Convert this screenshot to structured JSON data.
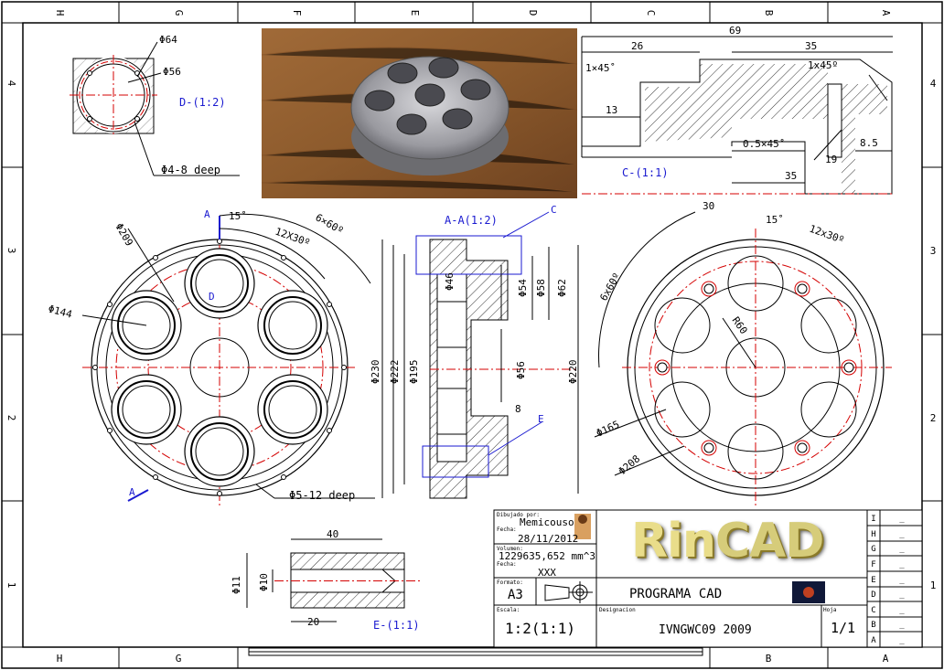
{
  "colors": {
    "line": "#000000",
    "center": "#d40000",
    "annot": "#1a1ad0",
    "hatch": "#000000"
  },
  "border": {
    "cols_top": [
      "H",
      "G",
      "F",
      "E",
      "D",
      "C",
      "B",
      "A"
    ],
    "cols_bottom": [
      "H",
      "G",
      "B",
      "A"
    ],
    "rows": [
      "4",
      "3",
      "2",
      "1"
    ]
  },
  "view_d": {
    "dia64": "Φ64",
    "dia56": "Φ56",
    "label": "D-(1:2)",
    "holes": "Φ4-8 deep"
  },
  "view_c": {
    "d69": "69",
    "d26": "26",
    "d35a": "35",
    "cham1": "1×45˚",
    "cham2": "1x45º",
    "d13": "13",
    "cham3": "0.5×45˚",
    "d19": "19",
    "d85": "8.5",
    "d35b": "35",
    "label": "C-(1:1)"
  },
  "front": {
    "a_top": "A",
    "a_bottom": "A",
    "d_mark": "D",
    "ang15": "15˚",
    "ang12x30": "12X30º",
    "ang6x60": "6×60º",
    "dia209": "Φ209",
    "dia144": "Φ144",
    "holes": "Φ5-12 deep"
  },
  "section": {
    "label": "A-A(1:2)",
    "c_mark": "C",
    "e_mark": "E",
    "d46": "Φ46",
    "d54": "Φ54",
    "d58": "Φ58",
    "d62": "Φ62",
    "d230": "Φ230",
    "d222": "Φ222",
    "d195": "Φ195",
    "d56": "Φ56",
    "d220": "Φ220",
    "d8": "8"
  },
  "back": {
    "d30": "30",
    "ang15": "15˚",
    "ang12x30": "12x30º",
    "ang6x60": "6x60º",
    "r60": "R60",
    "dia165": "Φ165",
    "dia208": "Φ208"
  },
  "view_e": {
    "d40": "40",
    "d11": "Φ11",
    "d10": "Φ10",
    "d20": "20",
    "label": "E-(1:1)"
  },
  "title_block": {
    "drawn_by_label": "Dibujado por:",
    "drawn_by": "Memicouso",
    "date_label": "Fecha:",
    "date": "28/11/2012",
    "volume_label": "Volumen:",
    "volume": "1229635,652 mm^3",
    "date2_label": "Fecha:",
    "date2": "XXX",
    "format_label": "Formato:",
    "format": "A3",
    "logo_a": "Rin",
    "logo_b": "CAD",
    "program": "PROGRAMA CAD",
    "scale_label": "Escala:",
    "scale": "1:2(1:1)",
    "designation_label": "Designacion",
    "designation": "IVNGWC09 2009",
    "sheet_label": "Hoja",
    "sheet": "1/1",
    "revisions": [
      "I",
      "H",
      "G",
      "F",
      "E",
      "D",
      "C",
      "B",
      "A"
    ],
    "rev_mark": "_"
  }
}
